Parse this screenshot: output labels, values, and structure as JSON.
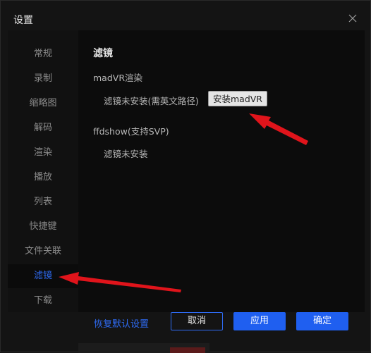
{
  "window": {
    "title": "设置"
  },
  "sidebar": {
    "items": [
      {
        "label": "常规"
      },
      {
        "label": "录制"
      },
      {
        "label": "缩略图"
      },
      {
        "label": "解码"
      },
      {
        "label": "渲染"
      },
      {
        "label": "播放"
      },
      {
        "label": "列表"
      },
      {
        "label": "快捷键"
      },
      {
        "label": "文件关联"
      },
      {
        "label": "滤镜"
      },
      {
        "label": "下载"
      }
    ],
    "active": "滤镜"
  },
  "content": {
    "section_title": "滤镜",
    "madvr": {
      "heading": "madVR渲染",
      "status": "滤镜未安装(需英文路径)",
      "install_button": "安装madVR"
    },
    "ffdshow": {
      "heading": "ffdshow(支持SVP)",
      "status": "滤镜未安装"
    }
  },
  "footer": {
    "restore_defaults": "恢复默认设置",
    "cancel": "取消",
    "apply": "应用",
    "ok": "确定"
  },
  "colors": {
    "accent": "#1f5ff0",
    "annotation_arrow": "#e0141b"
  },
  "icons": {
    "close": "close-icon"
  }
}
